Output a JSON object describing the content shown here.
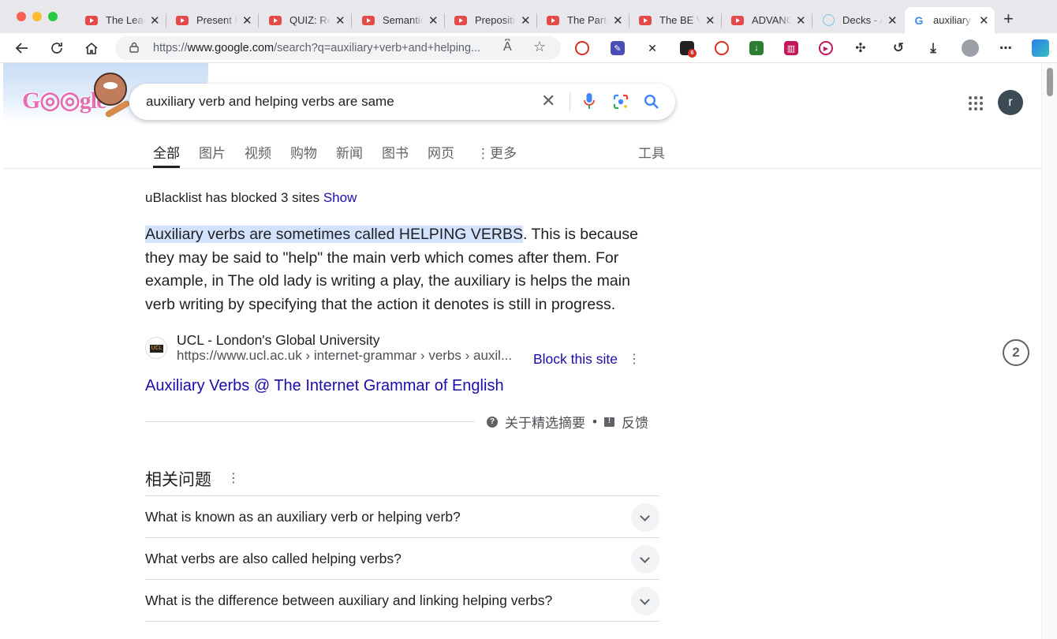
{
  "browser": {
    "tabs": [
      {
        "label": "The Lear"
      },
      {
        "label": "Present P"
      },
      {
        "label": "QUIZ: Re"
      },
      {
        "label": "Semantic"
      },
      {
        "label": "Prepositi"
      },
      {
        "label": "The Parti"
      },
      {
        "label": "The BE V"
      },
      {
        "label": "ADVANC"
      },
      {
        "label": "Decks - A"
      },
      {
        "label": "auxiliary"
      }
    ],
    "url_prefix": "https://",
    "url_domain": "www.google.com",
    "url_path": "/search?q=auxiliary+verb+and+helping...",
    "extension_badge": "6"
  },
  "search": {
    "query": "auxiliary verb and helping verbs are same",
    "tabs": [
      "全部",
      "图片",
      "视频",
      "购物",
      "新闻",
      "图书",
      "网页",
      "更多"
    ],
    "tools": "工具",
    "avatar_letter": "r"
  },
  "main": {
    "blocked_text": "uBlacklist has blocked 3 sites",
    "blocked_link": "Show",
    "snippet_highlight": "Auxiliary verbs are sometimes called HELPING VERBS",
    "snippet_rest": ". This is because they may be said to \"help\" the main verb which comes after them. For example, in The old lady is writing a play, the auxiliary is helps the main verb writing by specifying that the action it denotes is still in progress.",
    "source_site": "UCL - London's Global University",
    "source_cite": "https://www.ucl.ac.uk › internet-grammar › verbs › auxil...",
    "block_site": "Block this site",
    "result_title": "Auxiliary Verbs @ The Internet Grammar of English",
    "about_snippets": "关于精选摘要",
    "feedback": "反馈",
    "paa_heading": "相关问题",
    "paa_questions": [
      "What is known as an auxiliary verb or helping verb?",
      "What verbs are also called helping verbs?",
      "What is the difference between auxiliary and linking helping verbs?"
    ],
    "side_badge": "2"
  }
}
